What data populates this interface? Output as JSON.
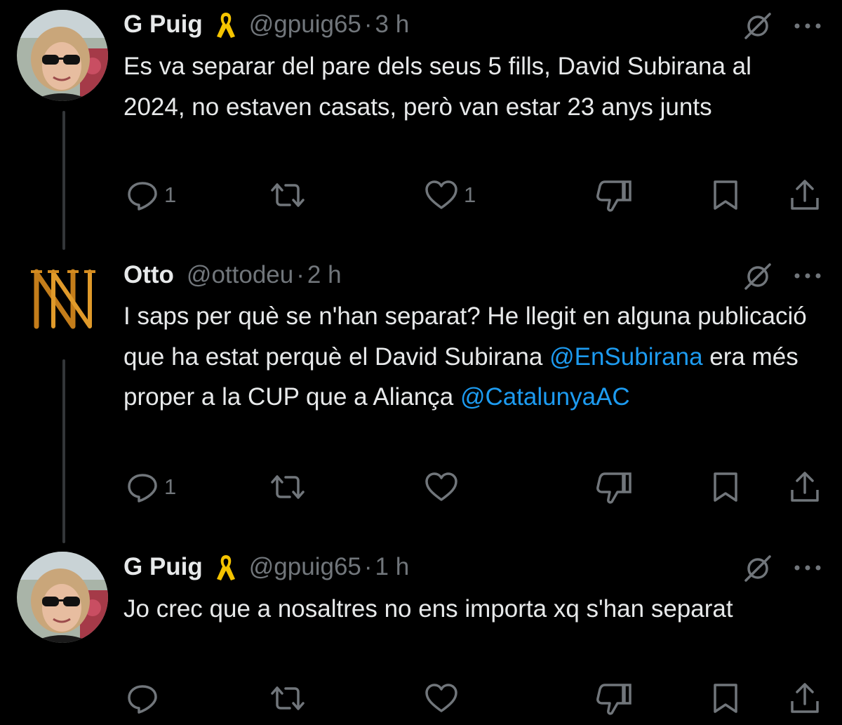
{
  "tweets": [
    {
      "name": "G Puig",
      "handle": "@gpuig65",
      "separator": "·",
      "time": "3 h",
      "text": "Es va separar del pare dels seus 5 fills, David Subirana al 2024,  no estaven casats, però van estar 23 anys junts",
      "reply_count": "1",
      "like_count": "1",
      "avatar": "woman-with-sunglasses-photo",
      "badge": "yellow-ribbon-icon"
    },
    {
      "name": "Otto",
      "handle": "@ottodeu",
      "separator": "·",
      "time": "2 h",
      "text_parts": [
        "I saps per què se n'han separat? He llegit en alguna publicació que ha estat perquè el David Subirana ",
        "@EnSubirana",
        " era més proper a la CUP que a Aliança ",
        "@CatalunyaAC"
      ],
      "reply_count": "1",
      "like_count": "",
      "avatar": "golden-N-logo"
    },
    {
      "name": "G Puig",
      "handle": "@gpuig65",
      "separator": "·",
      "time": "1 h",
      "text": "Jo crec que a nosaltres no ens importa xq s'han separat",
      "reply_count": "",
      "like_count": "",
      "avatar": "woman-with-sunglasses-photo",
      "badge": "yellow-ribbon-icon"
    }
  ],
  "icons": {
    "reply": "reply-icon",
    "repost": "repost-icon",
    "like": "like-icon",
    "dislike": "dislike-icon",
    "bookmark": "bookmark-icon",
    "share": "share-icon",
    "grok": "grok-icon",
    "more": "more-icon"
  },
  "colors": {
    "background": "#000000",
    "text": "#e7e9ea",
    "secondary": "#71767b",
    "link": "#1d9bf0",
    "ribbon": "#f5c400"
  }
}
